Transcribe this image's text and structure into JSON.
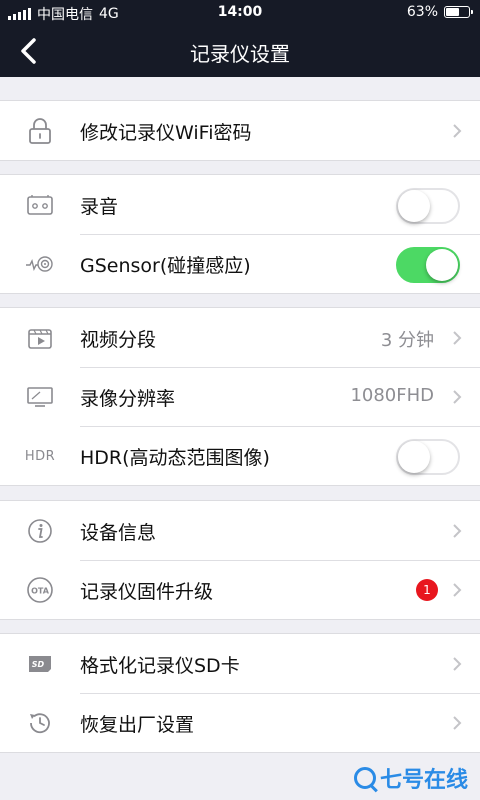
{
  "status_bar": {
    "carrier": "中国电信",
    "network": "4G",
    "time": "14:00",
    "battery": "63%",
    "battery_level": 0.63
  },
  "nav": {
    "title": "记录仪设置",
    "back_icon": "chevron-left-icon"
  },
  "sections": {
    "wifi": {
      "password_label": "修改记录仪WiFi密码"
    },
    "audio": {
      "record_label": "录音",
      "record_on": false,
      "gsensor_label": "GSensor(碰撞感应)",
      "gsensor_on": true
    },
    "video": {
      "segment_label": "视频分段",
      "segment_value": "3 分钟",
      "resolution_label": "录像分辨率",
      "resolution_value": "1080FHD",
      "hdr_icon_text": "HDR",
      "hdr_label": "HDR(高动态范围图像)",
      "hdr_on": false
    },
    "device": {
      "info_label": "设备信息",
      "firmware_label": "记录仪固件升级",
      "firmware_badge": "1"
    },
    "maintenance": {
      "format_label": "格式化记录仪SD卡",
      "reset_label": "恢复出厂设置"
    }
  },
  "watermark": {
    "text": "七号在线"
  },
  "colors": {
    "header_bg": "#161a26",
    "toggle_on": "#4cd964",
    "badge": "#e8161e",
    "page_bg": "#efeff4"
  }
}
